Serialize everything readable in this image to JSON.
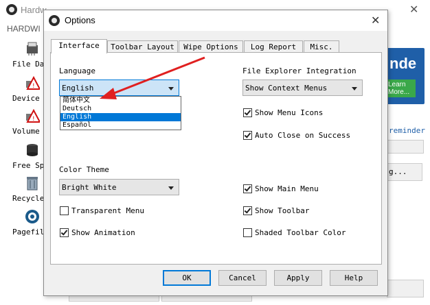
{
  "background_app": {
    "title": "Hardw",
    "subtitle": "HARDWI",
    "sidebar": [
      {
        "label": "File Da",
        "icon": "file-shredder-icon"
      },
      {
        "label": "Device",
        "icon": "device-warning-icon"
      },
      {
        "label": "Volume",
        "icon": "volume-warning-icon"
      },
      {
        "label": "Free Sp",
        "icon": "free-space-icon"
      },
      {
        "label": "Recycle",
        "icon": "recycle-bin-icon"
      },
      {
        "label": "Pagefil",
        "icon": "pagefile-icon"
      }
    ],
    "ad_text": "nde",
    "ad_button": "Learn More...",
    "reminder": "reminder",
    "partial_button": "g..."
  },
  "dialog": {
    "title": "Options",
    "tabs": [
      {
        "label": "Interface",
        "active": true
      },
      {
        "label": "Toolbar Layout",
        "active": false
      },
      {
        "label": "Wipe Options",
        "active": false
      },
      {
        "label": "Log Report",
        "active": false
      },
      {
        "label": "Misc.",
        "active": false
      }
    ],
    "interface": {
      "language_label": "Language",
      "language_value": "English",
      "language_options": [
        "简体中文",
        "Deutsch",
        "English",
        "Español"
      ],
      "language_selected": "English",
      "explorer_label": "File Explorer Integration",
      "explorer_value": "Show Context Menus",
      "color_theme_label": "Color Theme",
      "color_theme_value": "Bright White",
      "checkboxes": {
        "show_menu_icons": {
          "label": "Show Menu Icons",
          "checked": true
        },
        "auto_close": {
          "label": "Auto Close on Success",
          "checked": true
        },
        "show_main_menu": {
          "label": "Show Main Menu",
          "checked": true
        },
        "show_toolbar": {
          "label": "Show Toolbar",
          "checked": true
        },
        "shaded_toolbar": {
          "label": "Shaded Toolbar Color",
          "checked": false
        },
        "transparent_menu": {
          "label": "Transparent Menu",
          "checked": false
        },
        "show_animation": {
          "label": "Show Animation",
          "checked": true
        }
      }
    },
    "buttons": {
      "ok": "OK",
      "cancel": "Cancel",
      "apply": "Apply",
      "help": "Help"
    }
  },
  "colors": {
    "accent": "#0078d7",
    "annotation_arrow": "#e02020",
    "ad_bg": "#1f5fa8",
    "ad_button": "#3aa84a"
  }
}
